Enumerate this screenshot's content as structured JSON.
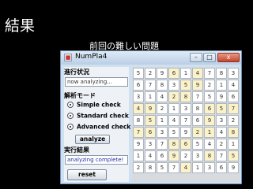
{
  "slide": {
    "title": "結果",
    "subtitle": "前回の難しい問題"
  },
  "window": {
    "title": "NumPla4",
    "min_glyph": "–",
    "max_glyph": "□",
    "close_glyph": "x"
  },
  "panel": {
    "progress_label": "進行状況",
    "progress_status": "now analyzing...",
    "mode_label": "解析モード",
    "modes": [
      "Simple check",
      "Standard check",
      "Advanced check"
    ],
    "analyze_label": "analyze",
    "result_label": "実行結果",
    "result_status": "analyzing complete!",
    "reset_label": "reset"
  },
  "grid": {
    "rows": [
      [
        "5",
        "2",
        "9",
        "6",
        "1",
        "4",
        "7",
        "8",
        "3"
      ],
      [
        "6",
        "7",
        "8",
        "3",
        "5",
        "9",
        "2",
        "1",
        "4"
      ],
      [
        "3",
        "1",
        "4",
        "2",
        "8",
        "7",
        "5",
        "9",
        "6"
      ],
      [
        "4",
        "9",
        "2",
        "1",
        "3",
        "8",
        "6",
        "5",
        "7"
      ],
      [
        "8",
        "5",
        "1",
        "4",
        "7",
        "6",
        "9",
        "3",
        "2"
      ],
      [
        "7",
        "6",
        "3",
        "5",
        "9",
        "2",
        "1",
        "4",
        "8"
      ],
      [
        "9",
        "3",
        "7",
        "8",
        "6",
        "5",
        "4",
        "2",
        "1"
      ],
      [
        "1",
        "4",
        "6",
        "9",
        "2",
        "3",
        "8",
        "7",
        "5"
      ],
      [
        "2",
        "8",
        "5",
        "7",
        "4",
        "1",
        "3",
        "6",
        "9"
      ]
    ],
    "highlighted": [
      [
        0,
        3
      ],
      [
        0,
        5
      ],
      [
        1,
        4
      ],
      [
        1,
        5
      ],
      [
        2,
        3
      ],
      [
        2,
        4
      ],
      [
        3,
        0
      ],
      [
        3,
        1
      ],
      [
        3,
        6
      ],
      [
        3,
        7
      ],
      [
        3,
        8
      ],
      [
        4,
        1
      ],
      [
        4,
        6
      ],
      [
        5,
        0
      ],
      [
        5,
        1
      ],
      [
        5,
        5
      ],
      [
        5,
        6
      ],
      [
        5,
        8
      ],
      [
        6,
        3
      ],
      [
        6,
        4
      ],
      [
        7,
        3
      ],
      [
        7,
        6
      ],
      [
        7,
        8
      ],
      [
        8,
        4
      ]
    ]
  }
}
